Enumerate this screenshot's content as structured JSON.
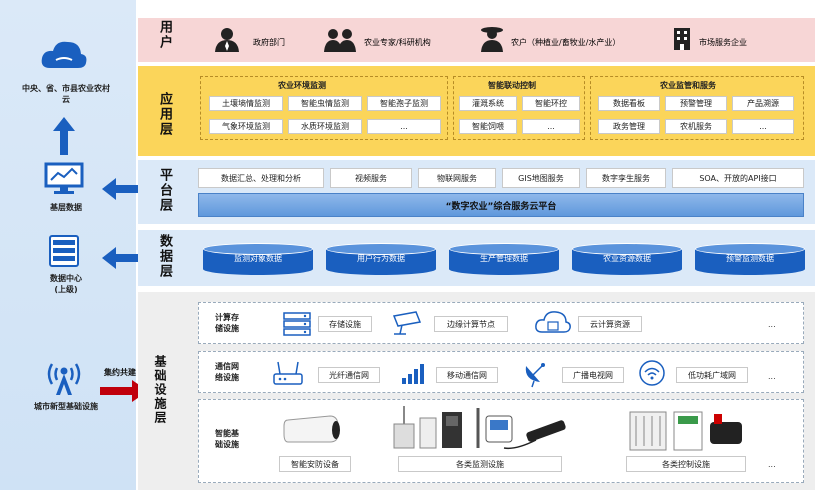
{
  "left": {
    "cloud_label": "中央、省、市县农业农村云",
    "base_data": "基层数据",
    "data_center": "数据中心",
    "data_center_sub": "(上级)",
    "city_infra": "城市新型基础设施",
    "shared": "集约共建"
  },
  "layers": {
    "user": "用户",
    "app": "应用层",
    "platform": "平台层",
    "data": "数据层",
    "infra": "基础设施层"
  },
  "users": [
    "政府部门",
    "农业专家/科研机构",
    "农户（种植业/畜牧业/水产业）",
    "市场服务企业"
  ],
  "app": {
    "env": {
      "title": "农业环境监测",
      "items": [
        "土壤墒情监测",
        "智能虫情监测",
        "智能孢子监测",
        "气象环境监测",
        "水质环境监测",
        "..."
      ]
    },
    "ctrl": {
      "title": "智能联动控制",
      "items": [
        "灌溉系统",
        "智能环控",
        "智能饲喂",
        "..."
      ]
    },
    "svc": {
      "title": "农业监管和服务",
      "items": [
        "数据看板",
        "预警管理",
        "产品溯源",
        "政务管理",
        "农机服务",
        "..."
      ]
    }
  },
  "platform": {
    "items": [
      "数据汇总、处理和分析",
      "视频服务",
      "物联网服务",
      "GIS地图服务",
      "数字孪生服务",
      "SOA、开放的API接口"
    ],
    "bar": "“数字农业”综合服务云平台"
  },
  "data": [
    "监测对象数据",
    "用户行为数据",
    "生产管理数据",
    "农业资源数据",
    "预警监测数据"
  ],
  "infra": {
    "compute": {
      "title": "计算存储设施",
      "items": [
        "存储设施",
        "边缘计算节点",
        "云计算资源"
      ],
      "more": "..."
    },
    "comm": {
      "title": "通信网络设施",
      "items": [
        "光纤通信网",
        "移动通信网",
        "广播电视网",
        "低功耗广域网"
      ],
      "more": "..."
    },
    "smart": {
      "title": "智能基础设施",
      "items": [
        "智能安防设备",
        "各类监测设施",
        "各类控制设施"
      ],
      "more": "..."
    }
  },
  "colors": {
    "user_bg": "#f7d6d6",
    "app_bg": "#fbd55a",
    "platform_bg": "#dbe9f8",
    "data_bg": "#dbe9f8",
    "infra_bg": "#eeeeee",
    "accent": "#1a5fbf",
    "arrow_red": "#c0000c"
  }
}
